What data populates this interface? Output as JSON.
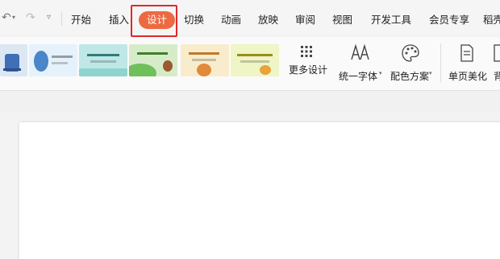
{
  "toolbar": {
    "undo_icon": "undo-icon",
    "redo_icon": "redo-icon",
    "more_icon": "dropdown-icon"
  },
  "menu": {
    "tabs": [
      {
        "label": "开始"
      },
      {
        "label": "插入"
      },
      {
        "label": "设计",
        "active": true
      },
      {
        "label": "切换"
      },
      {
        "label": "动画"
      },
      {
        "label": "放映"
      },
      {
        "label": "审阅"
      },
      {
        "label": "视图"
      },
      {
        "label": "开发工具"
      },
      {
        "label": "会员专享"
      },
      {
        "label": "稻壳"
      }
    ],
    "accent": "#ec6a42",
    "highlight": "#e0282c"
  },
  "ribbon": {
    "more_design": "更多设计",
    "unify_font": "统一字体",
    "color_scheme": "配色方案",
    "page_beautify": "单页美化",
    "background": "背"
  }
}
